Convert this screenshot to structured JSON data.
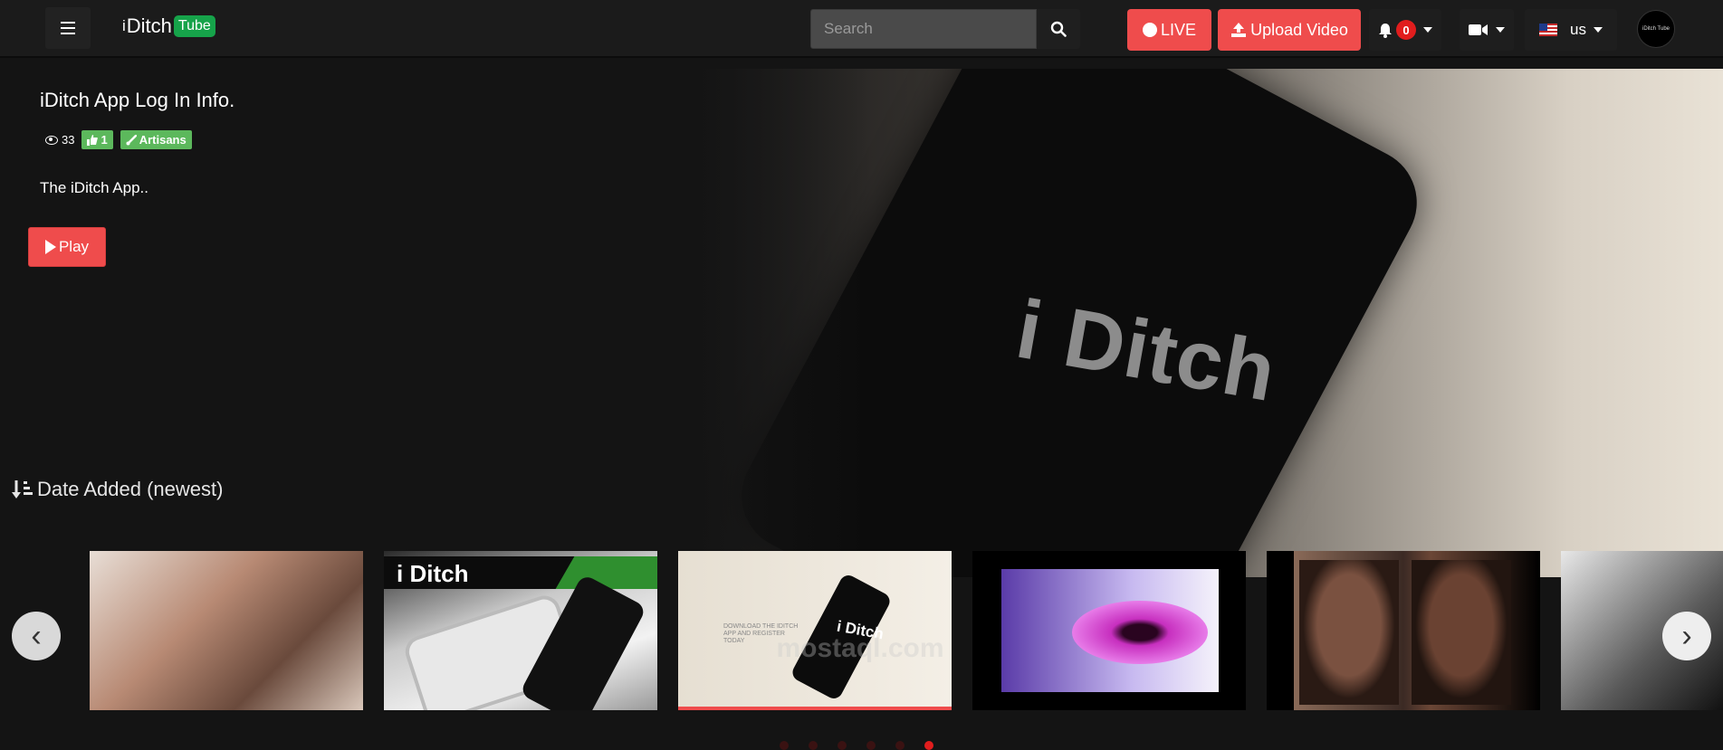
{
  "nav": {
    "logo_i": "i",
    "logo_ditch": "Ditch",
    "logo_tube": "Tube",
    "search_placeholder": "Search",
    "live_label": "LIVE",
    "upload_label": "Upload Video",
    "notification_count": "0",
    "language": "us",
    "avatar_text": "iDitch Tube"
  },
  "hero": {
    "title": "iDitch App Log In Info.",
    "views": "33",
    "likes": "1",
    "category": "Artisans",
    "description": "The iDitch App..",
    "play_label": "Play",
    "image_brand": "i Ditch"
  },
  "sort": {
    "label": "Date Added (newest)"
  },
  "carousel": {
    "thumb2_brand": "i Ditch",
    "thumb3_brand": "i Ditch",
    "thumb3_small": "DOWNLOAD THE IDITCH APP AND REGISTER TODAY",
    "prev_glyph": "‹",
    "next_glyph": "›",
    "watermark": "mostaql.com"
  },
  "colors": {
    "accent_red": "#ef4c4c",
    "tube_green": "#16a34a",
    "tag_green": "#5cb85c",
    "badge_red": "#e11d1d"
  }
}
